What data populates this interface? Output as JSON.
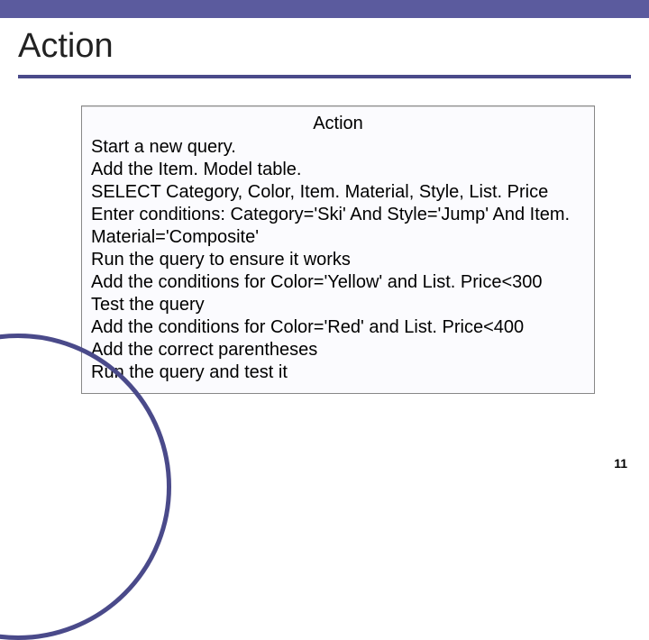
{
  "title": "Action",
  "box": {
    "header": "Action",
    "steps": [
      "Start a new query.",
      "Add the Item. Model table.",
      "SELECT Category, Color, Item. Material, Style, List. Price",
      "Enter conditions: Category='Ski' And Style='Jump' And Item. Material='Composite'",
      "Run the query to ensure it works",
      "Add the conditions for Color='Yellow' and List. Price<300",
      "Test the query",
      "Add the conditions for Color='Red' and List. Price<400",
      "Add the correct parentheses",
      "Run the query and test it"
    ]
  },
  "pageNumber": "11"
}
